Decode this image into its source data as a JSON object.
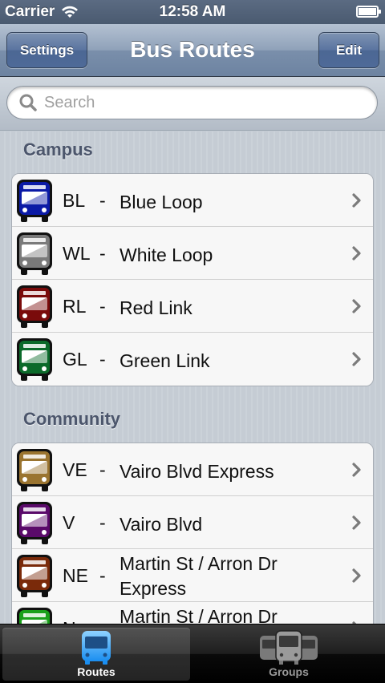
{
  "status_bar": {
    "carrier": "Carrier",
    "time": "12:58 AM",
    "wifi_icon": "wifi-icon",
    "battery_icon": "battery-icon"
  },
  "nav": {
    "title": "Bus Routes",
    "left_button": "Settings",
    "right_button": "Edit"
  },
  "search": {
    "placeholder": "Search",
    "value": ""
  },
  "sections": [
    {
      "header": "Campus",
      "routes": [
        {
          "code": "BL",
          "name": "Blue Loop",
          "color": "#0b1aa6"
        },
        {
          "code": "WL",
          "name": "White Loop",
          "color": "#7a7a7a"
        },
        {
          "code": "RL",
          "name": "Red Link",
          "color": "#7a0b0b"
        },
        {
          "code": "GL",
          "name": "Green Link",
          "color": "#0b6a2a"
        }
      ]
    },
    {
      "header": "Community",
      "routes": [
        {
          "code": "VE",
          "name": "Vairo Blvd Express",
          "color": "#9a7430"
        },
        {
          "code": "V",
          "name": "Vairo Blvd",
          "color": "#5a0a6a"
        },
        {
          "code": "NE",
          "name": "Martin St / Arron Dr Express",
          "color": "#7a2a0a"
        },
        {
          "code": "N",
          "name": "Martin St / Arron Dr",
          "color": "#1aa01a"
        }
      ]
    }
  ],
  "tab_bar": {
    "tabs": [
      {
        "label": "Routes",
        "selected": true,
        "icon": "bus-icon"
      },
      {
        "label": "Groups",
        "selected": false,
        "icon": "bus-group-icon"
      }
    ]
  }
}
